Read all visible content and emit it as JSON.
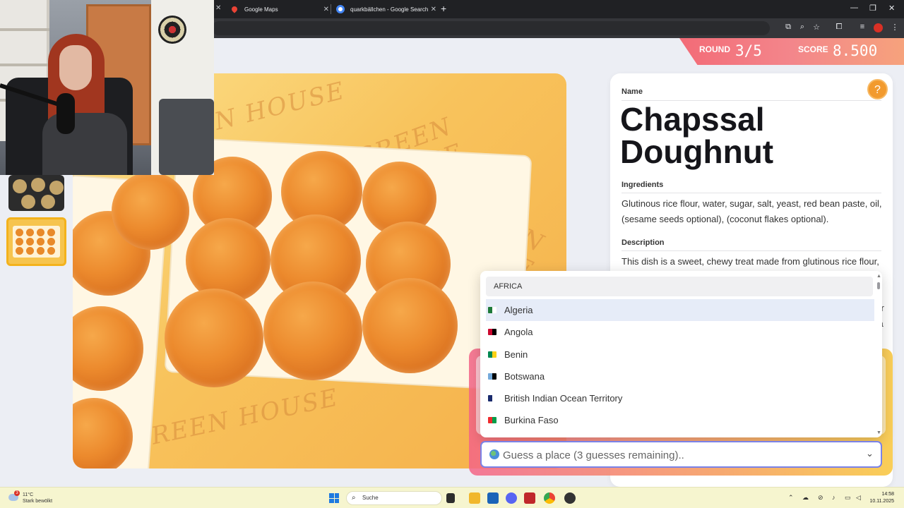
{
  "browser": {
    "tabs": [
      {
        "label": "Google Maps"
      },
      {
        "label": "quarkbällchen - Google Search"
      }
    ],
    "new_tab_glyph": "+",
    "window_controls": [
      "—",
      "❐",
      "✕"
    ]
  },
  "game": {
    "round_label": "ROUND",
    "round_value": "3/5",
    "score_label": "SCORE",
    "score_value": "8.500",
    "help_glyph": "?"
  },
  "dish": {
    "name_label": "Name",
    "name": "Chapssal Doughnut",
    "ingredients_label": "Ingredients",
    "ingredients": "Glutinous rice flour, water, sugar, salt, yeast, red bean paste, oil, (sesame seeds optional), (coconut flakes optional).",
    "description_label": "Description",
    "description": "This dish is a sweet, chewy treat made from glutinous rice flour, creating a crispy outer layer and a soft, chewy interior. Typically filled with sweetened red bean paste, it is deep-fried to golden perfection. The combination of textures from the crunchy exterior and smooth filling makes it a delightful snack, often enjoyed as a comforting dessert or a sweet indulgence with tea."
  },
  "photo": {
    "watermark_text": "GREEN HOUSE"
  },
  "guess": {
    "region_header": "AFRICA",
    "options": [
      {
        "label": "Algeria",
        "flag_colors": [
          "#1e7a3a",
          "#ffffff"
        ]
      },
      {
        "label": "Angola",
        "flag_colors": [
          "#cc092f",
          "#000000"
        ]
      },
      {
        "label": "Benin",
        "flag_colors": [
          "#008751",
          "#fcd116"
        ]
      },
      {
        "label": "Botswana",
        "flag_colors": [
          "#75aadb",
          "#000000"
        ]
      },
      {
        "label": "British Indian Ocean Territory",
        "flag_colors": [
          "#1a2b6d",
          "#ffffff"
        ]
      },
      {
        "label": "Burkina Faso",
        "flag_colors": [
          "#ef2b2d",
          "#009e49"
        ]
      }
    ],
    "placeholder": "Guess a place (3 guesses remaining)..",
    "value": ""
  },
  "taskbar": {
    "weather_temp": "11°C",
    "weather_desc": "Stark bewölkt",
    "weather_badge": "3",
    "search_label": "Suche",
    "time": "14:58",
    "date": "10.11.2025"
  },
  "colors": {
    "banner_start": "#f36b77",
    "banner_end": "#f6a27c",
    "help_button": "#f29a2e",
    "guess_border": "#7a82e8"
  }
}
